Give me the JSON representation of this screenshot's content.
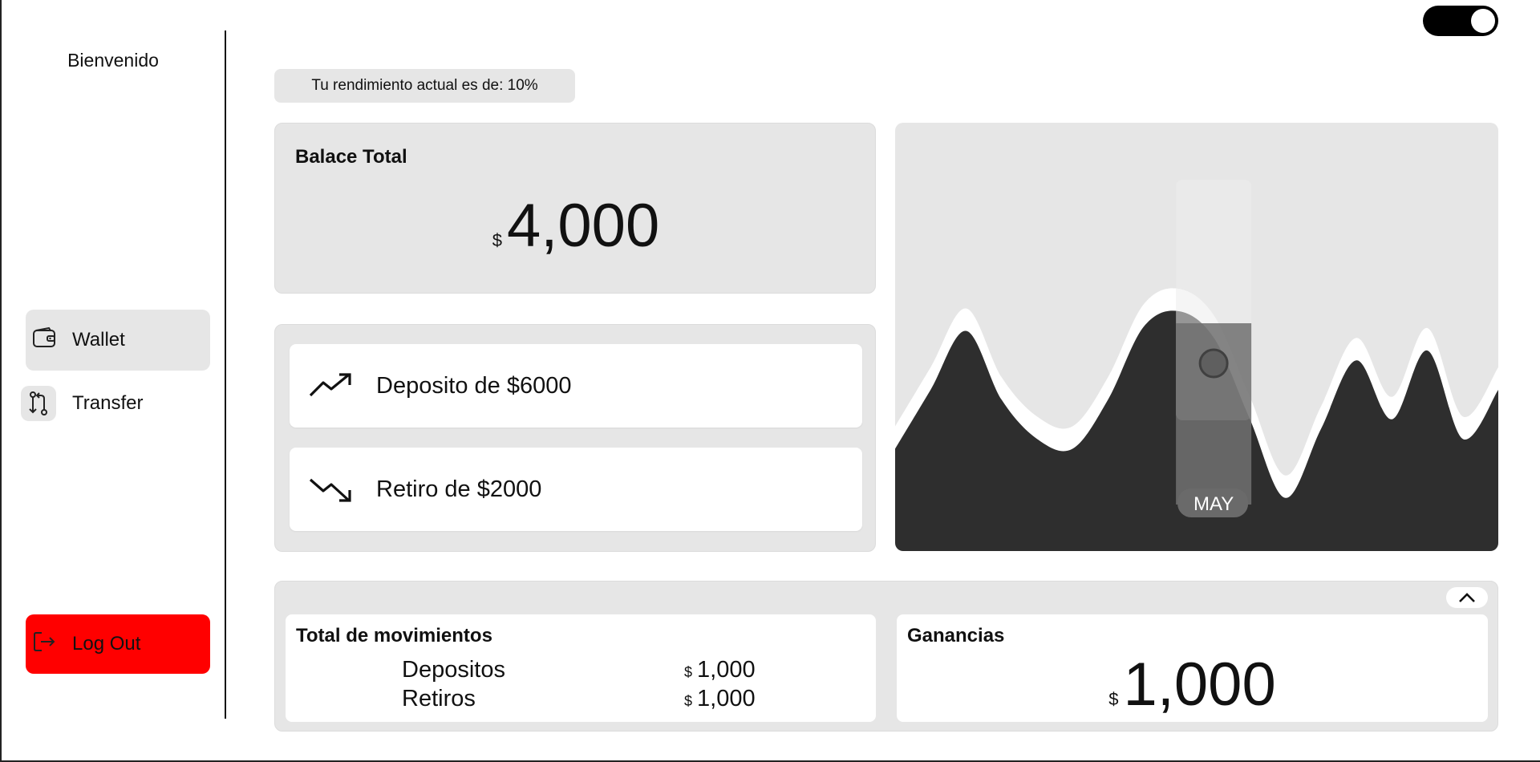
{
  "sidebar": {
    "welcome": "Bienvenido",
    "items": [
      {
        "label": "Wallet",
        "icon": "wallet-icon",
        "active": true
      },
      {
        "label": "Transfer",
        "icon": "transfer-icon",
        "active": false
      }
    ],
    "logout_label": "Log Out",
    "logout_color": "#ff0000"
  },
  "header": {
    "theme_toggle_on": true,
    "performance_text": "Tu rendimiento actual es de: 10%"
  },
  "balance": {
    "title": "Balace Total",
    "currency": "$",
    "amount": "4,000"
  },
  "movements": [
    {
      "label": "Deposito de $6000",
      "icon": "trending-up-icon"
    },
    {
      "label": "Retiro de $2000",
      "icon": "trending-down-icon"
    }
  ],
  "chart_data": {
    "type": "area",
    "series": [
      {
        "values": [
          0.3,
          0.6,
          0.9,
          0.55,
          0.35,
          0.3,
          0.55,
          0.92,
          1.0,
          0.86,
          0.45,
          0.05,
          0.4,
          0.75,
          0.45,
          0.8,
          0.35,
          0.6
        ]
      }
    ],
    "highlight_label": "MAY",
    "colors": {
      "fill": "#2e2e2e",
      "outline": "#ffffff",
      "highlight": "#707070"
    }
  },
  "summary": {
    "totals_title": "Total de movimientos",
    "rows": [
      {
        "label": "Depositos",
        "currency": "$",
        "value": "1,000"
      },
      {
        "label": "Retiros",
        "currency": "$",
        "value": "1,000"
      }
    ],
    "gains_title": "Ganancias",
    "gains_currency": "$",
    "gains_value": "1,000"
  }
}
